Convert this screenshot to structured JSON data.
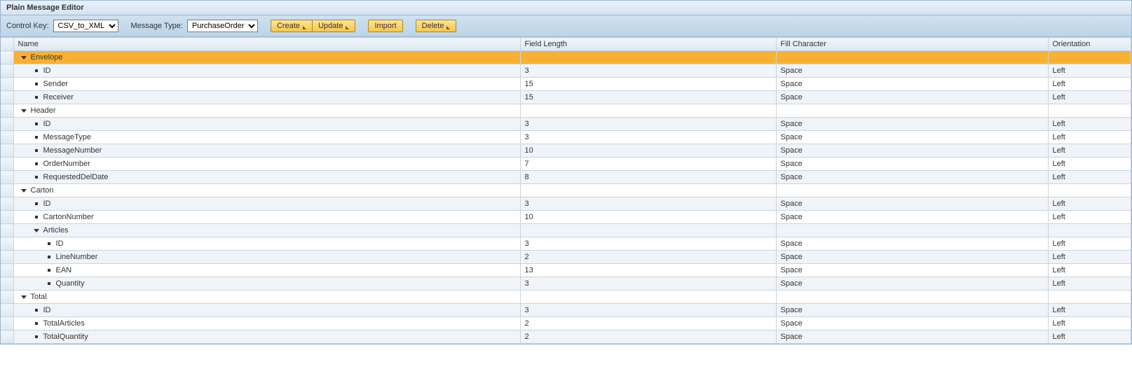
{
  "panel": {
    "title": "Plain Message Editor"
  },
  "toolbar": {
    "controlKeyLabel": "Control Key:",
    "controlKeyValue": "CSV_to_XML",
    "messageTypeLabel": "Message Type:",
    "messageTypeValue": "PurchaseOrder",
    "buttons": {
      "create": "Create",
      "update": "Update",
      "import": "Import",
      "delete": "Delete"
    }
  },
  "columns": {
    "name": "Name",
    "fieldLength": "Field Length",
    "fillCharacter": "Fill Character",
    "orientation": "Orientation"
  },
  "rows": [
    {
      "section": true,
      "selected": true,
      "depth": 0,
      "name": "Envelope"
    },
    {
      "depth": 1,
      "name": "ID",
      "len": "3",
      "fill": "Space",
      "orient": "Left"
    },
    {
      "depth": 1,
      "name": "Sender",
      "len": "15",
      "fill": "Space",
      "orient": "Left"
    },
    {
      "depth": 1,
      "name": "Receiver",
      "len": "15",
      "fill": "Space",
      "orient": "Left"
    },
    {
      "section": true,
      "depth": 0,
      "name": "Header"
    },
    {
      "depth": 1,
      "name": "ID",
      "len": "3",
      "fill": "Space",
      "orient": "Left"
    },
    {
      "depth": 1,
      "name": "MessageType",
      "len": "3",
      "fill": "Space",
      "orient": "Left"
    },
    {
      "depth": 1,
      "name": "MessageNumber",
      "len": "10",
      "fill": "Space",
      "orient": "Left"
    },
    {
      "depth": 1,
      "name": "OrderNumber",
      "len": "7",
      "fill": "Space",
      "orient": "Left"
    },
    {
      "depth": 1,
      "name": "RequestedDelDate",
      "len": "8",
      "fill": "Space",
      "orient": "Left"
    },
    {
      "section": true,
      "depth": 0,
      "name": "Carton"
    },
    {
      "depth": 1,
      "name": "ID",
      "len": "3",
      "fill": "Space",
      "orient": "Left"
    },
    {
      "depth": 1,
      "name": "CartonNumber",
      "len": "10",
      "fill": "Space",
      "orient": "Left"
    },
    {
      "section": true,
      "depth": 1,
      "name": "Articles"
    },
    {
      "depth": 2,
      "name": "ID",
      "len": "3",
      "fill": "Space",
      "orient": "Left"
    },
    {
      "depth": 2,
      "name": "LineNumber",
      "len": "2",
      "fill": "Space",
      "orient": "Left"
    },
    {
      "depth": 2,
      "name": "EAN",
      "len": "13",
      "fill": "Space",
      "orient": "Left"
    },
    {
      "depth": 2,
      "name": "Quantity",
      "len": "3",
      "fill": "Space",
      "orient": "Left"
    },
    {
      "section": true,
      "depth": 0,
      "name": "Total"
    },
    {
      "depth": 1,
      "name": "ID",
      "len": "3",
      "fill": "Space",
      "orient": "Left"
    },
    {
      "depth": 1,
      "name": "TotalArticles",
      "len": "2",
      "fill": "Space",
      "orient": "Left"
    },
    {
      "depth": 1,
      "name": "TotalQuantity",
      "len": "2",
      "fill": "Space",
      "orient": "Left"
    }
  ]
}
